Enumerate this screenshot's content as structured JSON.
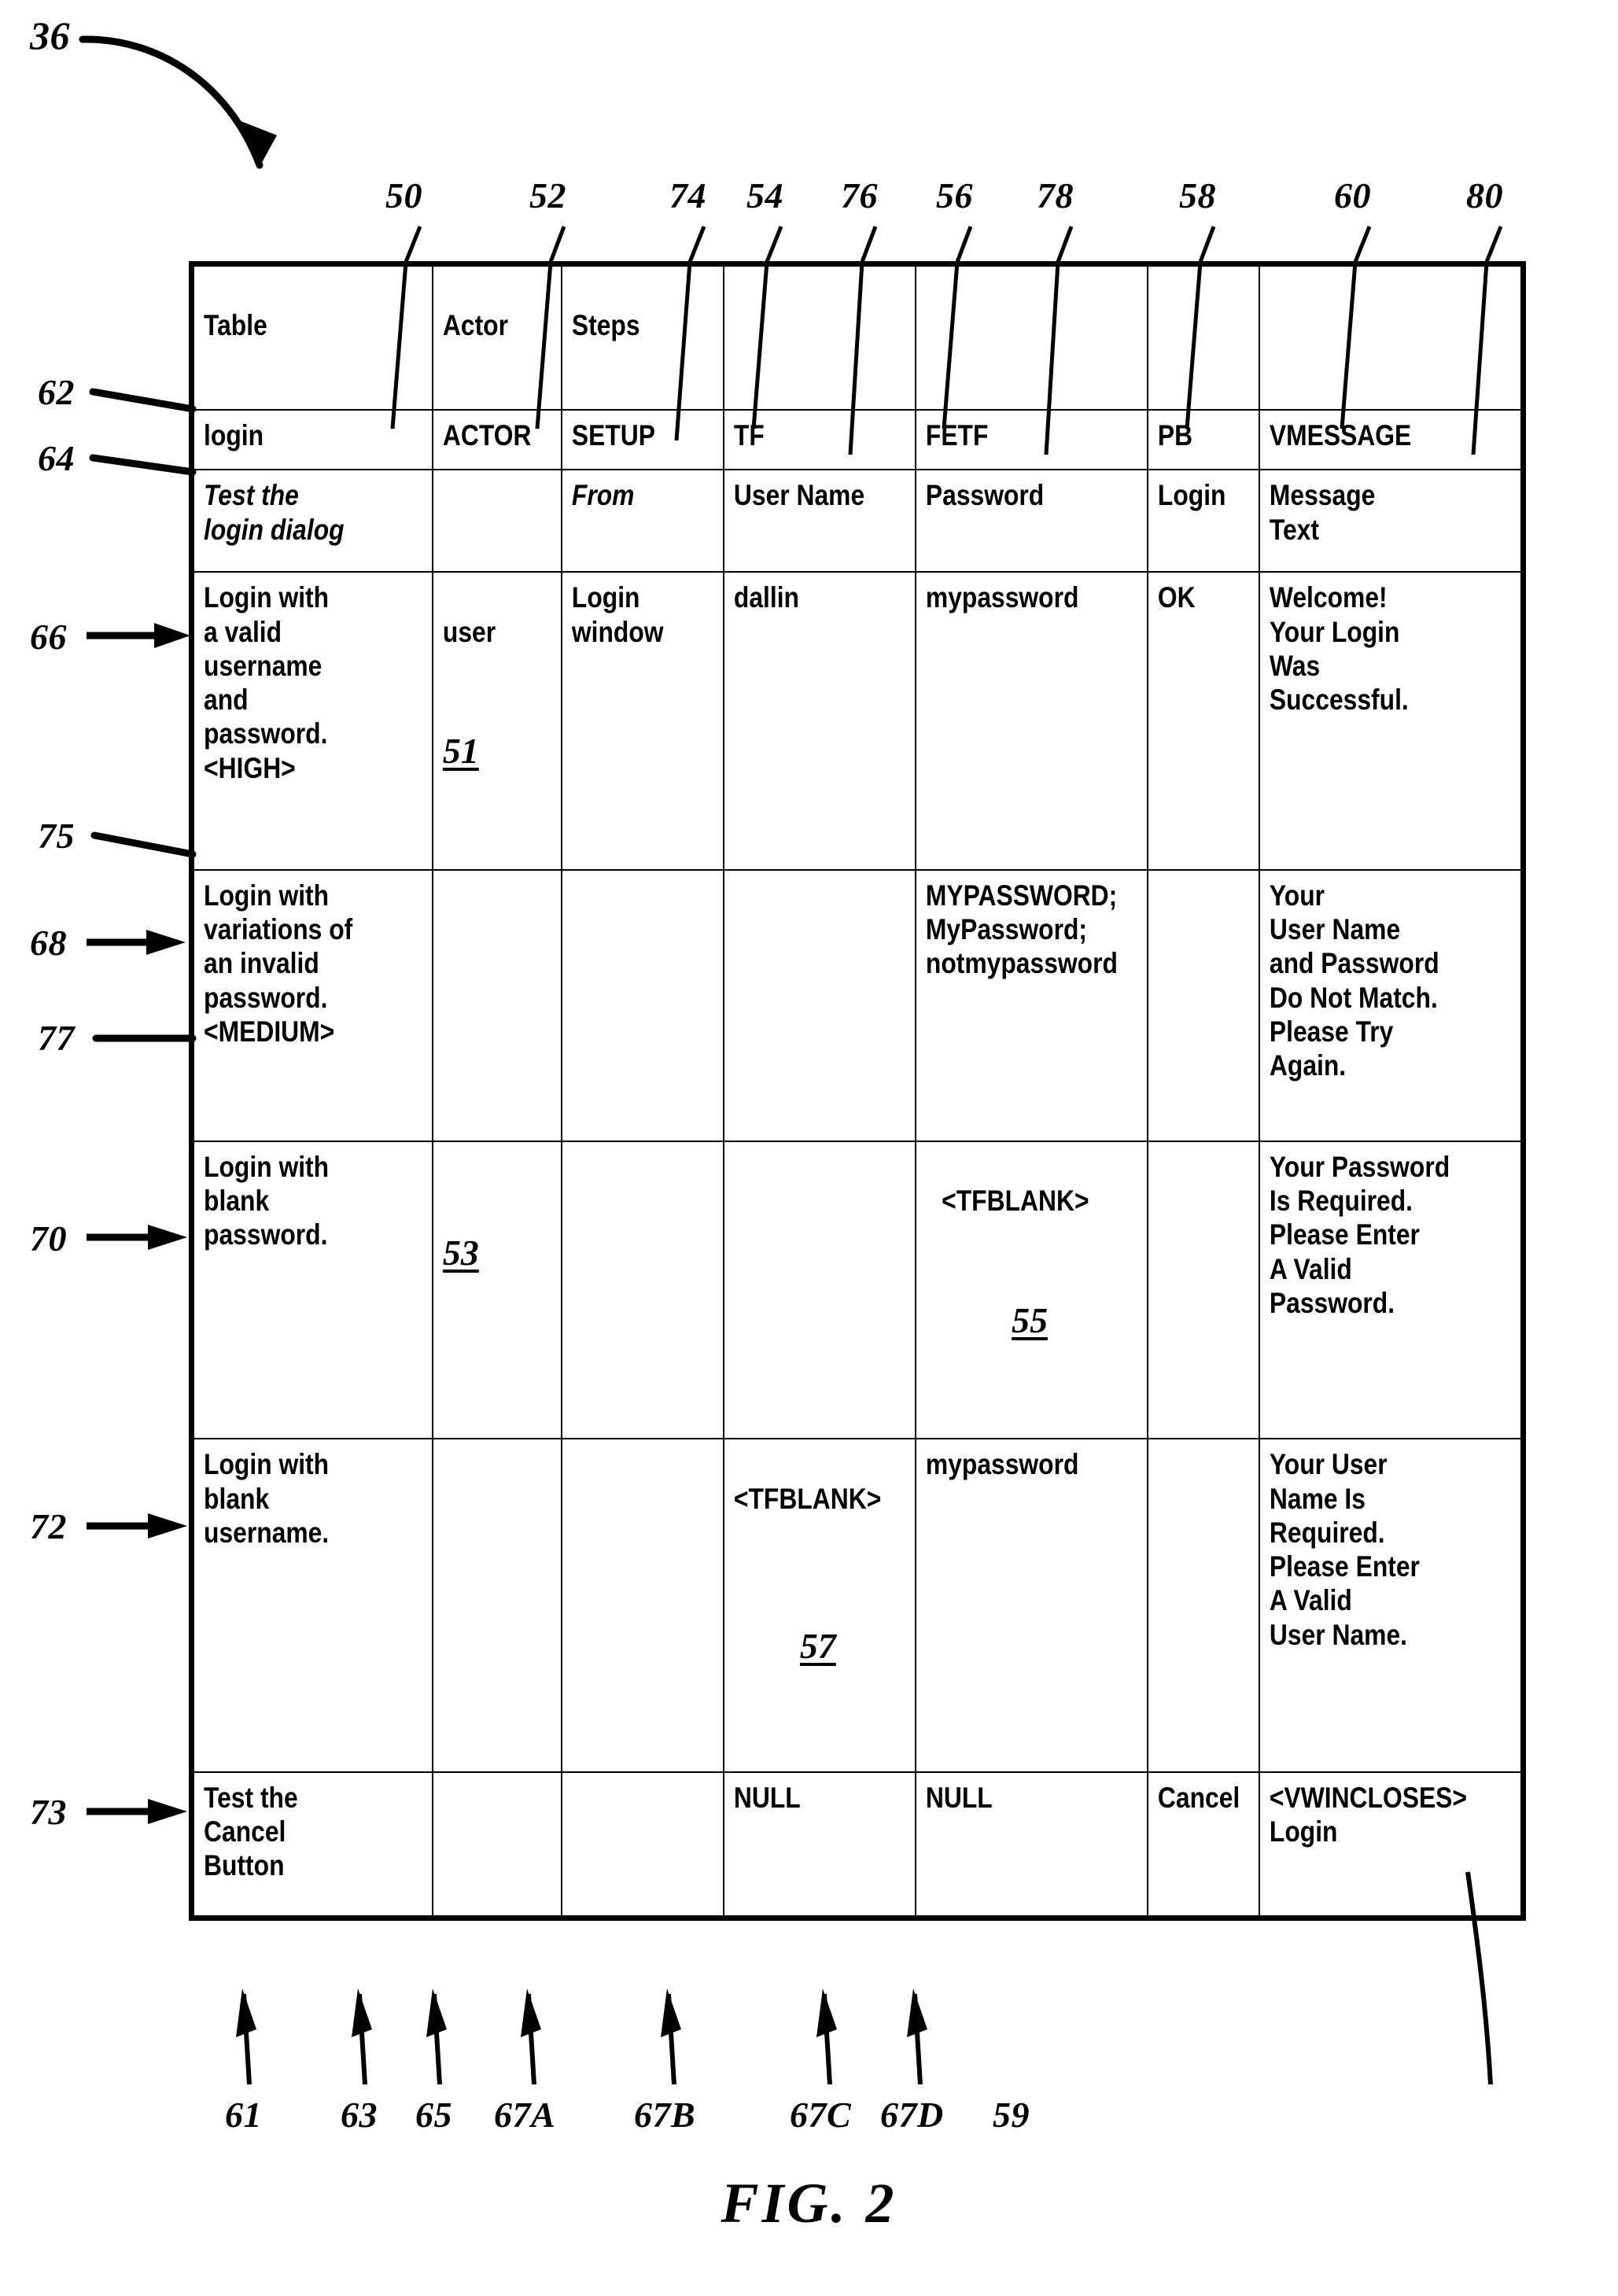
{
  "figure": {
    "caption": "FIG.  2",
    "figure_ref": "36"
  },
  "table": {
    "column_refs_top": [
      "50",
      "52",
      "74",
      "54",
      "76",
      "56",
      "78",
      "58",
      "60",
      "80"
    ],
    "column_refs_bottom": [
      "61",
      "63",
      "65",
      "67A",
      "67B",
      "67C",
      "67D",
      "59"
    ],
    "row_refs_left": [
      "62",
      "64",
      "66",
      "75",
      "68",
      "77",
      "70",
      "72",
      "73"
    ],
    "header_row": {
      "cols": [
        "",
        "Table",
        "Actor",
        "Steps",
        "",
        "",
        "",
        "",
        ""
      ]
    },
    "rows": [
      {
        "ref": "62",
        "cells": [
          {
            "text": "login"
          },
          {
            "text": "ACTOR"
          },
          {
            "text": "SETUP"
          },
          {
            "text": "TF"
          },
          {
            "text": "FETF"
          },
          {
            "text": "PB"
          },
          {
            "text": "VMESSAGE"
          }
        ]
      },
      {
        "ref": "64",
        "italic": true,
        "cells": [
          {
            "text": "Test the\nlogin dialog"
          },
          {
            "text": ""
          },
          {
            "text": "From"
          },
          {
            "text": "User Name"
          },
          {
            "text": "Password"
          },
          {
            "text": "Login"
          },
          {
            "text": "Message\nText"
          }
        ]
      },
      {
        "ref": "66",
        "cells": [
          {
            "text": "Login with\na valid\nusername\nand\npassword.\n<HIGH>"
          },
          {
            "text": "user",
            "ref": "51"
          },
          {
            "text": "Login\nwindow"
          },
          {
            "text": "dallin"
          },
          {
            "text": "mypassword"
          },
          {
            "text": "OK"
          },
          {
            "text": "Welcome!\nYour Login\nWas\nSuccessful."
          }
        ]
      },
      {
        "ref": "68",
        "cells": [
          {
            "text": "Login with\nvariations of\nan invalid\npassword.\n<MEDIUM>"
          },
          {
            "text": ""
          },
          {
            "text": ""
          },
          {
            "text": ""
          },
          {
            "text": "MYPASSWORD;\nMyPassword;\nnotmypassword"
          },
          {
            "text": ""
          },
          {
            "text": "Your\nUser Name\nand Password\nDo Not Match.\nPlease Try\nAgain."
          }
        ]
      },
      {
        "ref": "70",
        "cells": [
          {
            "text": "Login with\nblank\npassword."
          },
          {
            "text": "",
            "ref": "53"
          },
          {
            "text": ""
          },
          {
            "text": ""
          },
          {
            "text": "<TFBLANK>",
            "ref": "55",
            "center": true
          },
          {
            "text": ""
          },
          {
            "text": "Your Password\nIs Required.\nPlease Enter\nA Valid\nPassword."
          }
        ]
      },
      {
        "ref": "72",
        "cells": [
          {
            "text": "Login with\nblank\nusername."
          },
          {
            "text": ""
          },
          {
            "text": ""
          },
          {
            "text": "<TFBLANK>",
            "ref": "57",
            "center": true
          },
          {
            "text": "mypassword"
          },
          {
            "text": ""
          },
          {
            "text": "Your User\nName Is\nRequired.\nPlease Enter\nA Valid\nUser Name."
          }
        ]
      },
      {
        "ref": "73",
        "cells": [
          {
            "text": "Test the\nCancel\nButton"
          },
          {
            "text": ""
          },
          {
            "text": ""
          },
          {
            "text": "NULL"
          },
          {
            "text": "NULL"
          },
          {
            "text": "Cancel"
          },
          {
            "text": "<VWINCLOSES>\nLogin"
          }
        ]
      }
    ]
  },
  "header_labels": {
    "table": "Table",
    "actor": "Actor",
    "steps": "Steps"
  },
  "colors": {
    "ink": "#000000",
    "paper": "#ffffff"
  }
}
